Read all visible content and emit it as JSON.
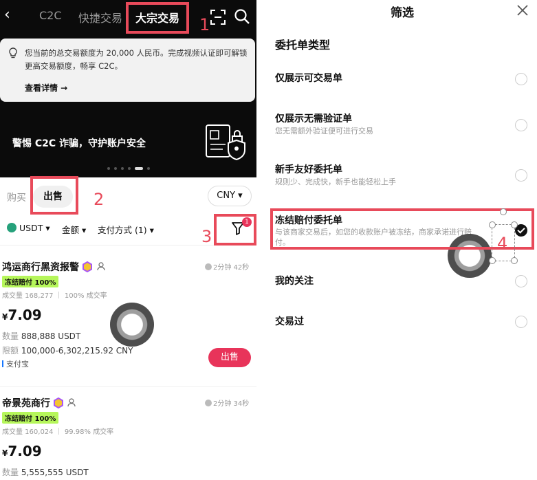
{
  "left": {
    "nav": {
      "back": "‹",
      "tabs": [
        "C2C",
        "快捷交易",
        "大宗交易"
      ],
      "active_tab": "大宗交易"
    },
    "notice": {
      "text": "您当前的总交易额度为 20,000 人民币。完成视频认证即可解锁更高交易额度，畅享 C2C。",
      "link": "查看详情 →"
    },
    "banner": {
      "text": "警惕 C2C 诈骗，守护账户安全",
      "slide": 5,
      "slides": 6
    },
    "trade_tabs": {
      "buy": "购买",
      "sell": "出售"
    },
    "currency": "CNY ▾",
    "filters": {
      "asset": "USDT ▾",
      "amount": "金额 ▾",
      "payment": "支付方式 (1) ▾",
      "badge": "1"
    },
    "cards": [
      {
        "merchant": "鸿运商行黑资报警",
        "time": "2分钟 42秒",
        "tag": "冻结赔付 100%",
        "stats": "成交量 168,277 ｜ 100% 成交率",
        "currency_symbol": "¥",
        "price": "7.09",
        "qty_label": "数量",
        "qty": "888,888 USDT",
        "limit_label": "限额",
        "limit": "100,000-6,302,215.92 CNY",
        "payment": "支付宝",
        "action": "出售"
      },
      {
        "merchant": "帝景苑商行",
        "time": "2分钟 34秒",
        "tag": "冻结赔付 100%",
        "stats": "成交量 160,024 ｜ 99.98% 成交率",
        "currency_symbol": "¥",
        "price": "7.09",
        "qty_label": "数量",
        "qty": "5,555,555 USDT"
      }
    ],
    "annotations": [
      "1",
      "2",
      "3"
    ]
  },
  "right": {
    "title": "筛选",
    "section": "委托单类型",
    "options": [
      {
        "title": "仅展示可交易单",
        "sub": "",
        "checked": false
      },
      {
        "title": "仅展示无需验证单",
        "sub": "您无需额外验证便可进行交易",
        "checked": false
      },
      {
        "title": "新手友好委托单",
        "sub": "规则少、完成快，新手也能轻松上手",
        "checked": false
      },
      {
        "title": "冻结赔付委托单",
        "sub": "与该商家交易后，如您的收款账户被冻结，商家承诺进行赔付。",
        "checked": true
      },
      {
        "title": "我的关注",
        "sub": "",
        "checked": false
      },
      {
        "title": "交易过",
        "sub": "",
        "checked": false
      }
    ],
    "annotation": "4"
  },
  "colors": {
    "accent": "#e8345a",
    "annotation": "#e84a5a",
    "tag": "#b6f65b"
  }
}
